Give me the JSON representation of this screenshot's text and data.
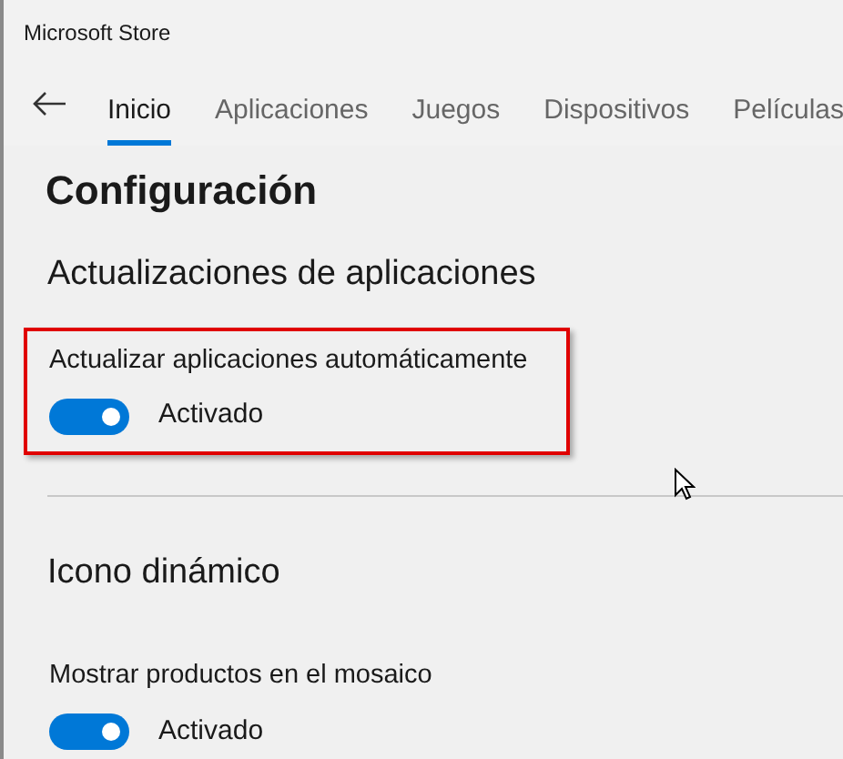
{
  "window": {
    "title": "Microsoft Store"
  },
  "tabs": [
    {
      "label": "Inicio",
      "selected": true
    },
    {
      "label": "Aplicaciones",
      "selected": false
    },
    {
      "label": "Juegos",
      "selected": false
    },
    {
      "label": "Dispositivos",
      "selected": false
    },
    {
      "label": "Películas",
      "selected": false
    }
  ],
  "page_title": "Configuración",
  "sections": [
    {
      "title": "Actualizaciones de aplicaciones",
      "highlighted": true,
      "setting": {
        "label": "Actualizar aplicaciones automáticamente",
        "on": true,
        "state_text": "Activado"
      }
    },
    {
      "title": "Icono dinámico",
      "highlighted": false,
      "setting": {
        "label": "Mostrar productos en el mosaico",
        "on": true,
        "state_text": "Activado"
      }
    }
  ]
}
